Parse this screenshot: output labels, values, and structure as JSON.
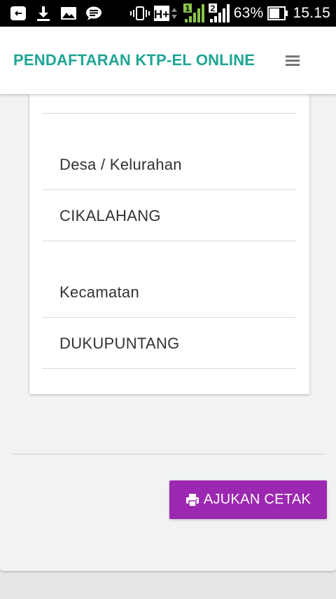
{
  "status_bar": {
    "battery": "63%",
    "time": "15.15",
    "network": "H+",
    "sim1": "1",
    "sim2": "2",
    "icons_left": [
      "add-box-icon",
      "download-icon",
      "image-icon",
      "message-icon"
    ],
    "icons_right": [
      "vibrate-icon",
      "hplus-network-icon",
      "signal-sim1-icon",
      "signal-sim2-icon",
      "battery-icon"
    ]
  },
  "app_bar": {
    "title": "PENDAFTARAN KTP-EL ONLINE",
    "title_color": "#1fa595",
    "menu_icon": "hamburger-menu-icon"
  },
  "card": {
    "fields": [
      {
        "label": "Desa / Kelurahan",
        "value": "CIKALAHANG"
      },
      {
        "label": "Kecamatan",
        "value": "DUKUPUNTANG"
      }
    ]
  },
  "actions": {
    "print_button_label": "AJUKAN CETAK",
    "print_button_icon": "printer-icon",
    "print_button_color": "#9c27b0"
  }
}
